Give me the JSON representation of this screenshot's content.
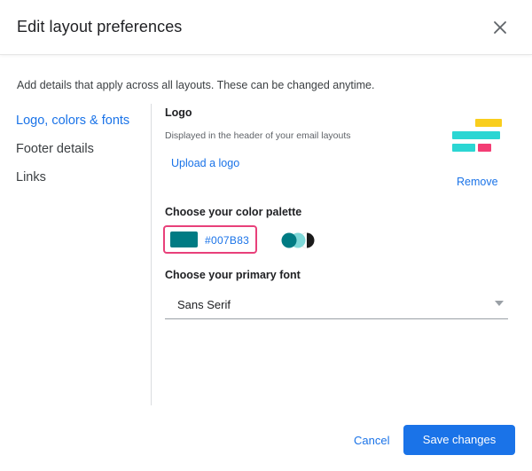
{
  "dialog": {
    "title": "Edit layout preferences",
    "subtitle": "Add details that apply across all layouts. These can be changed anytime."
  },
  "nav": {
    "items": [
      {
        "label": "Logo, colors & fonts",
        "active": true
      },
      {
        "label": "Footer details",
        "active": false
      },
      {
        "label": "Links",
        "active": false
      }
    ]
  },
  "logo": {
    "heading": "Logo",
    "description": "Displayed in the header of your email layouts",
    "upload_label": "Upload a logo",
    "remove_label": "Remove"
  },
  "palette": {
    "heading": "Choose your color palette",
    "hex": "#007B83",
    "swatch_color": "#007b83",
    "highlight_color": "#e8407a"
  },
  "font": {
    "heading": "Choose your primary font",
    "selected": "Sans Serif"
  },
  "footer": {
    "cancel_label": "Cancel",
    "save_label": "Save changes"
  },
  "colors": {
    "accent": "#1a73e8",
    "logo_teal": "#2bd6d3",
    "logo_yellow": "#f9ce1d",
    "logo_pink": "#f33d74"
  }
}
